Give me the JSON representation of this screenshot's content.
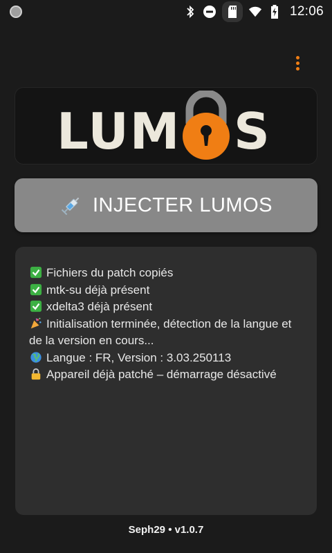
{
  "status_bar": {
    "time": "12:06",
    "icons": [
      "notification-dot-icon",
      "bluetooth-icon",
      "do-not-disturb-icon",
      "sd-card-icon",
      "wifi-icon",
      "battery-charging-icon"
    ]
  },
  "menu": {
    "icon": "overflow-menu-icon",
    "color": "#f07e14"
  },
  "logo": {
    "letters_left": "LUM",
    "letters_right": "S",
    "lock_color": "#f07e14"
  },
  "inject_button": {
    "label": "INJECTER LUMOS",
    "icon": "syringe-icon",
    "background": "#888888"
  },
  "log": {
    "entries": [
      {
        "icon": "check-icon",
        "text": "Fichiers du patch copiés"
      },
      {
        "icon": "check-icon",
        "text": "mtk-su déjà présent"
      },
      {
        "icon": "check-icon",
        "text": "xdelta3 déjà présent"
      },
      {
        "icon": "party-popper-icon",
        "text": "Initialisation terminée, détection de la langue et de la version en cours..."
      },
      {
        "icon": "globe-icon",
        "text": "Langue : FR, Version : 3.03.250113"
      },
      {
        "icon": "lock-icon",
        "text": "Appareil déjà patché – démarrage désactivé"
      }
    ]
  },
  "footer": {
    "text": "Seph29 • v1.0.7"
  }
}
